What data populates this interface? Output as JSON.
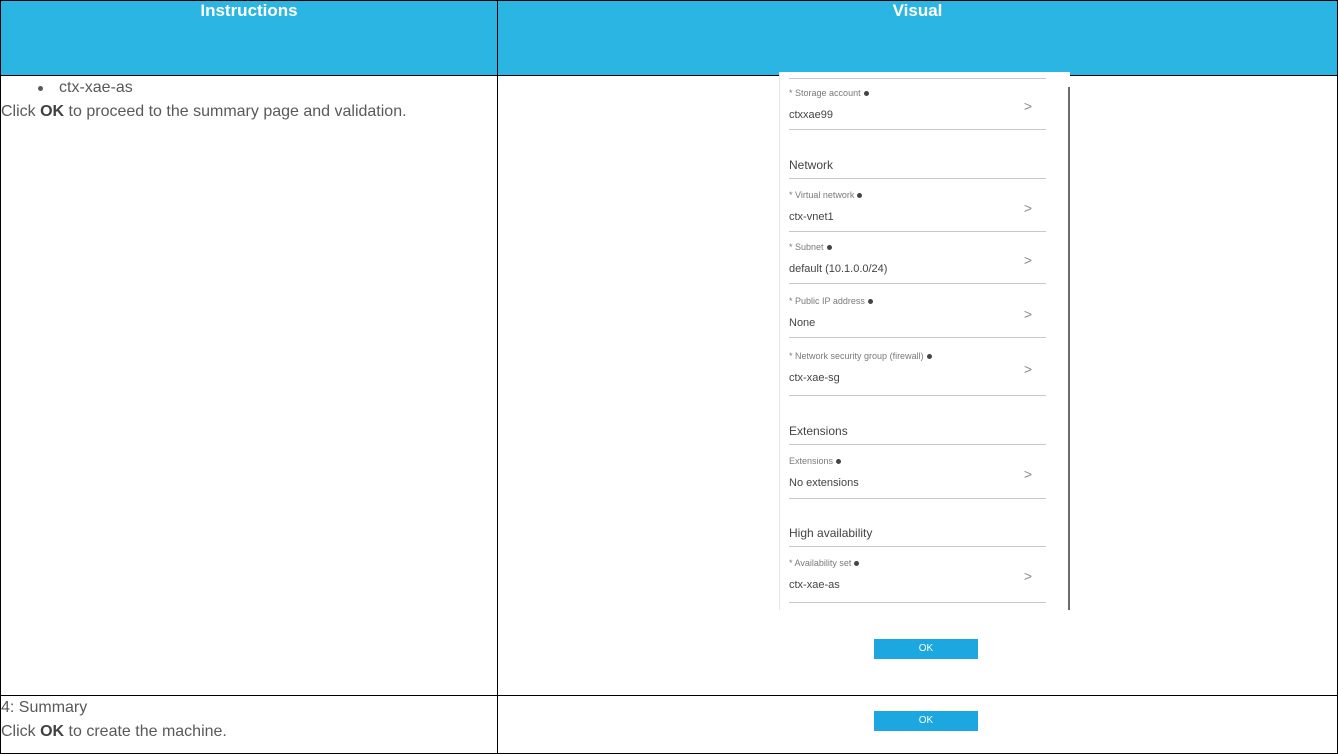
{
  "header": {
    "col1": "Instructions",
    "col2": "Visual"
  },
  "row1": {
    "bullet": "ctx-xae-as",
    "text_before": "Click ",
    "bold": "OK",
    "text_after": " to proceed to the summary page and validation."
  },
  "row2": {
    "title": "4: Summary",
    "text_before": "Click ",
    "bold": "OK",
    "text_after": " to create the machine."
  },
  "blade": {
    "storage": {
      "label": "Storage account",
      "value": "ctxxae99"
    },
    "network_section": "Network",
    "vnet": {
      "label": "Virtual network",
      "value": "ctx-vnet1"
    },
    "subnet": {
      "label": "Subnet",
      "value": "default (10.1.0.0/24)"
    },
    "publicip": {
      "label": "Public IP address",
      "value": "None"
    },
    "nsg": {
      "label": "Network security group (firewall)",
      "value": "ctx-xae-sg"
    },
    "extensions_section": "Extensions",
    "extensions": {
      "label": "Extensions",
      "value": "No extensions"
    },
    "ha_section": "High availability",
    "avset": {
      "label": "Availability set",
      "value": "ctx-xae-as"
    },
    "required_mark": "*",
    "chevron": ">"
  },
  "ok_button_1": "OK",
  "ok_button_2": "OK",
  "colors": {
    "header_bg": "#2bb5e2",
    "button": "#1da7e0"
  }
}
